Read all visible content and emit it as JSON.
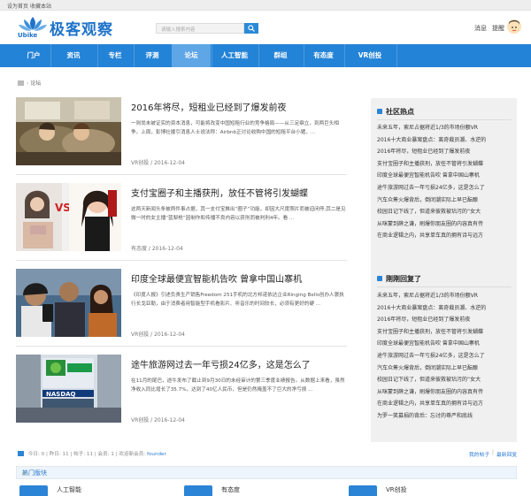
{
  "topbar": {
    "set_home": "设为首页",
    "bookmark": "收藏本站"
  },
  "brand": {
    "name_cn": "极客观察",
    "name_en": "Ubike"
  },
  "search": {
    "placeholder": "请输入搜索内容"
  },
  "header": {
    "messages": "消息",
    "reminders": "提醒"
  },
  "nav": {
    "items": [
      "门户",
      "资讯",
      "专栏",
      "评测",
      "论坛",
      "人工智能",
      "群组",
      "有态度",
      "VR创投"
    ],
    "active": "论坛"
  },
  "breadcrumb": {
    "current": "论坛"
  },
  "articles": [
    {
      "title": "2016年将尽，短租业已经到了爆发前夜",
      "desc": "一则尚未被证实的资本消息，可能将改变中国短租行业的竞争格局——从三足鼎立，到两巨头相争。上周，彭博社援引消息人士说法称：Airbnb正讨论收购中国的短租平台小猪，...",
      "meta": "VR创投 / 2016-12-04"
    },
    {
      "title": "支付宝圈子和主播获刑，放任不管将引发蝴蝶",
      "desc": "这两天新闻头条被两件事占据，其一支付宝推出“圈子”功能，却因大尺度照片而被迫闭停;其二是见微一时的女主播“蓝梨枪”因制作和传播不良内容以获刑而被判刑4年。看 ...",
      "meta": "有态度 / 2016-12-04"
    },
    {
      "title": "印度全球最便宜智能机告吹 曾拿中国山寨机",
      "desc": "《印度人报》引述负责生产销售Freedom 251手机的北方邦诺依达企业Ringing Bells创办人褒执行长戈亚勒，由于消费者用智能型手机看影片、听音乐的时间较长，必须有更好的硬 ...",
      "meta": "VR创投 / 2016-12-04"
    },
    {
      "title": "途牛旅游网过去一年亏损24亿多，这是怎么了",
      "desc": "在11月的尾巴，途牛发布了截止到9月30日的未经审计的第三季度业绩报告。从数据上来看，虽然净收入同比增长了35.7%，达到了40亿人民币，但是仍然掩盖不了巨大的净亏损 ...",
      "meta": "VR创投 / 2016-12-04"
    }
  ],
  "sidebar": {
    "hot_title": "社区热点",
    "hot_lines": [
      "未来五年，索尼占据将近1/3的市场份额VR",
      "2016十大商业暴案盘点：离奇裁员潮、水逆的",
      "2016年将尽，短租业已经到了爆发前夜",
      "支付宝圈子和主播获刑，放任不管将引发蝴蝶",
      "印度全球最便宜智能机告吹 曾拿中国山寨机",
      "途牛旅游网过去一年亏损24亿多，这是怎么了",
      "汽车众筹火爆背后，倒闭潮实际上早已酝酿",
      "校园日记下线了，但道来彼救被玷污的“女大",
      "从咪蒙到薛之谦，刷爆你朋友圈的内容真有传",
      "在商业逻辑之内，共享单车真的拥有诗与远方"
    ],
    "reply_title": "刚刚回复了",
    "reply_lines": [
      "未来五年，索尼占据将近1/3的市场份额VR",
      "2016十大商业暴案盘点：离奇裁员潮、水逆的",
      "2016年将尽，短租业已经到了爆发前夜",
      "支付宝圈子和主播获刑，放任不管将引发蝴蝶",
      "印度全球最便宜智能机告吹 曾拿中国山寨机",
      "途牛旅游网过去一年亏损24亿多，这是怎么了",
      "汽车众筹火爆背后，倒闭潮实际上早已酝酿",
      "校园日记下线了，但道来彼救被玷污的“女大",
      "从咪蒙到薛之谦，刷爆你朋友圈的内容真有传",
      "在商业逻辑之内，共享单车真的拥有诗与远方",
      "为罗一笑募捐的背后：忘讨的尊严和底线"
    ]
  },
  "stats": {
    "today": "今日: 0",
    "yesterday": "昨日: 11",
    "posts": "帖子: 11",
    "members": "会员: 1",
    "welcome": "欢迎新会员: ",
    "new_member": "founder",
    "my_posts": "我的帖子",
    "latest_replies": "最新回复"
  },
  "hot_boards": {
    "title": "热门版块",
    "items": [
      "人工智能",
      "有态度",
      "VR创投"
    ]
  },
  "colors": {
    "brand_blue": "#2383d7",
    "nav_active": "#5fa6e6",
    "link_blue": "#2b7bd0",
    "sidebar_bg": "#f0f0f0"
  },
  "icons": [
    "home-icon",
    "search-icon",
    "avatar",
    "lotus-logo-icon",
    "bullet-icon",
    "stats-icon",
    "board-icon"
  ]
}
